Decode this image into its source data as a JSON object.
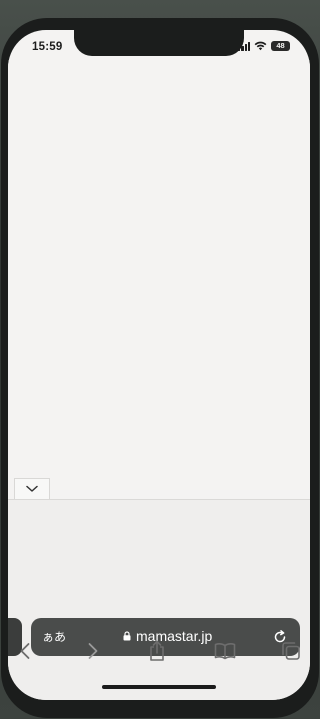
{
  "status_bar": {
    "time": "15:59",
    "battery": "48",
    "icons": [
      "cellular-signal-icon",
      "wifi-icon",
      "battery-icon"
    ]
  },
  "page": {
    "collapse_icon": "chevron-down-icon"
  },
  "address_bar": {
    "text_size_label": "ぁあ",
    "url": "mamastar.jp",
    "icons": [
      "lock-icon",
      "reload-icon"
    ]
  },
  "toolbar": {
    "items": [
      {
        "name": "back",
        "icon": "chevron-left-icon"
      },
      {
        "name": "forward",
        "icon": "chevron-right-icon"
      },
      {
        "name": "share",
        "icon": "share-icon"
      },
      {
        "name": "bookmarks",
        "icon": "book-icon"
      },
      {
        "name": "tabs",
        "icon": "tabs-icon"
      }
    ]
  },
  "colors": {
    "screen_background": "#f4f3f2",
    "address_bar": "#4a4c4b",
    "toolbar_icon": "#6d6d6d"
  }
}
